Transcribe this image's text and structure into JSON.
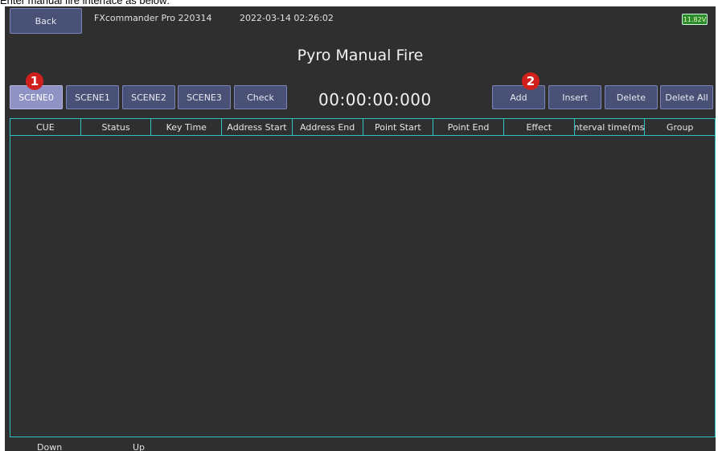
{
  "caption": "Enter manual fire interface as below:",
  "header": {
    "back_label": "Back",
    "app_name": "FXcommander Pro 220314",
    "datetime": "2022-03-14 02:26:02",
    "battery": "11.82V"
  },
  "title": "Pyro Manual Fire",
  "scenes": [
    "SCENE0",
    "SCENE1",
    "SCENE2",
    "SCENE3"
  ],
  "check_label": "Check",
  "timer": "00:00:00:000",
  "actions": {
    "add": "Add",
    "insert": "Insert",
    "delete": "Delete",
    "delete_all": "Delete All"
  },
  "table": {
    "columns": [
      "CUE",
      "Status",
      "Key Time",
      "Address Start",
      "Address End",
      "Point Start",
      "Point End",
      "Effect",
      "Interval time(ms)",
      "Group"
    ],
    "rows": []
  },
  "footer": {
    "down": "Down",
    "up": "Up"
  },
  "markers": [
    "1",
    "2"
  ],
  "colors": {
    "accent": "#2ec4c4",
    "button": "#4a5176",
    "active": "#8f92c4",
    "marker": "#d0201c"
  }
}
